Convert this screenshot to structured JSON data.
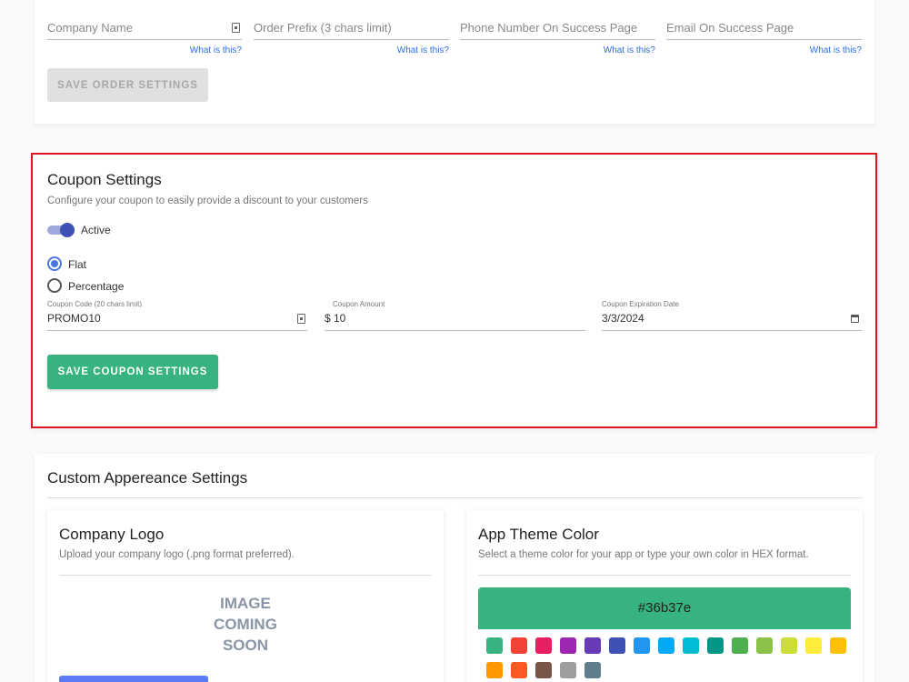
{
  "order_settings": {
    "fields": [
      {
        "placeholder": "Company Name",
        "help": "What is this?"
      },
      {
        "placeholder": "Order Prefix (3 chars limit)",
        "help": "What is this?"
      },
      {
        "placeholder": "Phone Number On Success Page",
        "help": "What is this?"
      },
      {
        "placeholder": "Email On Success Page",
        "help": "What is this?"
      }
    ],
    "save_label": "SAVE ORDER SETTINGS"
  },
  "coupon_settings": {
    "title": "Coupon Settings",
    "description": "Configure your coupon to easily provide a discount to your customers",
    "toggle_label": "Active",
    "radio_flat": "Flat",
    "radio_percentage": "Percentage",
    "code_label": "Coupon Code (20 chars limit)",
    "code_value": "PROMO10",
    "amount_label": "Coupon Amount",
    "amount_prefix": "$",
    "amount_value": "10",
    "expiry_label": "Coupon Expiration Date",
    "expiry_value": "3/3/2024",
    "save_label": "SAVE COUPON SETTINGS"
  },
  "appearance": {
    "title": "Custom Appereance Settings",
    "logo": {
      "title": "Company Logo",
      "description": "Upload your company logo (.png format preferred).",
      "placeholder_line1": "IMAGE",
      "placeholder_line2": "COMING",
      "placeholder_line3": "SOON"
    },
    "theme": {
      "title": "App Theme Color",
      "description": "Select a theme color for your app or type your own color in HEX format.",
      "hex": "#36b37e",
      "swatches": [
        "#36b37e",
        "#f44336",
        "#e91e63",
        "#9c27b0",
        "#673ab7",
        "#3f51b5",
        "#2196f3",
        "#03a9f4",
        "#00bcd4",
        "#009688",
        "#4caf50",
        "#8bc34a",
        "#cddc39",
        "#ffeb3b",
        "#ffc107",
        "#ff9800",
        "#ff5722",
        "#795548",
        "#9e9e9e",
        "#607d8b"
      ]
    }
  },
  "colors": {
    "accent_green": "#36b37e",
    "highlight_red": "#e0141e",
    "link_blue": "#2f6fe0",
    "toggle_blue": "#3f51b5",
    "upload_button": "#5b7cf5"
  }
}
